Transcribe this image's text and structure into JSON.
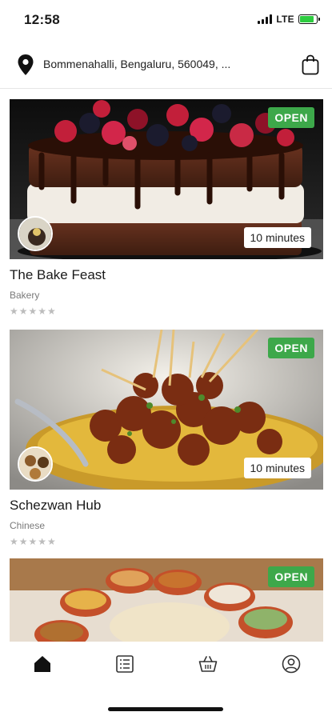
{
  "status_bar": {
    "time": "12:58",
    "network": "LTE",
    "battery_level": 0.85,
    "icons": [
      "signal-icon",
      "battery-charging-icon"
    ]
  },
  "header": {
    "location": "Bommenahalli, Bengaluru, 560049, ...",
    "icons": [
      "location-pin-icon",
      "shopping-bag-icon"
    ]
  },
  "colors": {
    "open_badge": "#3da84a",
    "text_primary": "#1a1a1a",
    "text_secondary": "#7a7a7a",
    "stars": "#bcbcbc"
  },
  "restaurants": [
    {
      "name": "The Bake Feast",
      "category": "Bakery",
      "status": "OPEN",
      "delivery_time": "10 minutes",
      "rating_stars": "★★★★★",
      "image": "chocolate-berry-cake"
    },
    {
      "name": "Schezwan Hub",
      "category": "Chinese",
      "status": "OPEN",
      "delivery_time": "10 minutes",
      "rating_stars": "★★★★★",
      "image": "chilli-manchurian-plate"
    },
    {
      "status": "OPEN",
      "image": "curry-bowls-and-rotis"
    }
  ],
  "bottom_nav": {
    "items": [
      "home-icon",
      "orders-list-icon",
      "cart-basket-icon",
      "profile-icon"
    ],
    "active": "home-icon"
  }
}
